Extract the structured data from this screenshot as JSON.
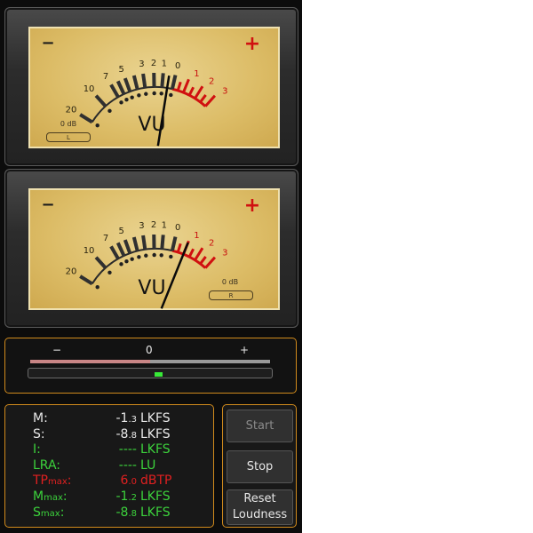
{
  "meters": [
    {
      "scale_black": [
        "20",
        "10",
        "7",
        "5",
        "3",
        "2",
        "1",
        "0"
      ],
      "scale_red": [
        "1",
        "2",
        "3"
      ],
      "minus": "−",
      "plus": "+",
      "vu": "VU",
      "zero_db": "0 dB",
      "channel": "L",
      "needle_db": -0.5
    },
    {
      "scale_black": [
        "20",
        "10",
        "7",
        "5",
        "3",
        "2",
        "1",
        "0"
      ],
      "scale_red": [
        "1",
        "2",
        "3"
      ],
      "minus": "−",
      "plus": "+",
      "vu": "VU",
      "zero_db": "0 dB",
      "channel": "R",
      "needle_db": 1.0
    }
  ],
  "balance": {
    "minus": "−",
    "zero": "0",
    "plus": "+",
    "value": 0.02
  },
  "stats": [
    {
      "label": "M:",
      "sub": "",
      "value_main": "-1",
      "value_sub": ".3",
      "unit": "LKFS",
      "color": "#e8e8e8"
    },
    {
      "label": "S:",
      "sub": "",
      "value_main": "-8",
      "value_sub": ".8",
      "unit": "LKFS",
      "color": "#e8e8e8"
    },
    {
      "label": "I:",
      "sub": "",
      "value_main": "----",
      "value_sub": "",
      "unit": "LKFS",
      "color": "#3cd23c"
    },
    {
      "label": "LRA:",
      "sub": "",
      "value_main": "----",
      "value_sub": "",
      "unit": "LU",
      "color": "#3cd23c"
    },
    {
      "label": "TP",
      "sub": "max",
      "label_end": ":",
      "value_main": "6",
      "value_sub": ".0",
      "unit": "dBTP",
      "color": "#e02020"
    },
    {
      "label": "M",
      "sub": "max",
      "label_end": ":",
      "value_main": "-1",
      "value_sub": ".2",
      "unit": "LKFS",
      "color": "#3cd23c"
    },
    {
      "label": "S",
      "sub": "max",
      "label_end": ":",
      "value_main": "-8",
      "value_sub": ".8",
      "unit": "LKFS",
      "color": "#3cd23c"
    }
  ],
  "buttons": {
    "start": "Start",
    "stop": "Stop",
    "reset_line1": "Reset",
    "reset_line2": "Loudness"
  },
  "colors": {
    "accent_orange": "#d08a1c",
    "green": "#3cd23c",
    "red": "#e02020",
    "meter_face": "#dcbc66"
  }
}
